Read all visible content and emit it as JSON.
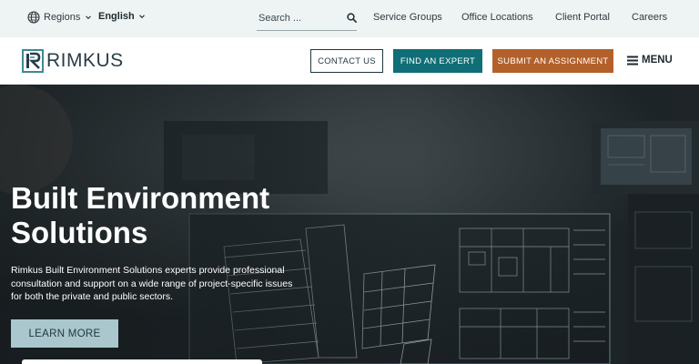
{
  "utility": {
    "regions_label": "Regions",
    "language_label": "English",
    "search_placeholder": "Search ...",
    "links": [
      "Service Groups",
      "Office Locations",
      "Client Portal",
      "Careers"
    ]
  },
  "header": {
    "logo_text": "RIMKUS",
    "contact_label": "CONTACT US",
    "expert_label": "FIND AN EXPERT",
    "submit_label": "SUBMIT AN ASSIGNMENT",
    "menu_label": "MENU"
  },
  "hero": {
    "title": "Built Environment Solutions",
    "description": "Rimkus Built Environment Solutions experts provide professional consultation and support on a wide range of project-specific issues for both the private and public sectors.",
    "cta_label": "LEARN MORE"
  },
  "colors": {
    "utility_bg": "#eef4f4",
    "accent_teal": "#0f6e76",
    "accent_orange": "#b3602b",
    "learn_more_bg": "#a9c7cc",
    "dark_text": "#1f3640"
  },
  "icons": [
    "globe-icon",
    "chevron-down-icon",
    "search-icon",
    "hamburger-icon",
    "rimkus-logo-mark"
  ]
}
